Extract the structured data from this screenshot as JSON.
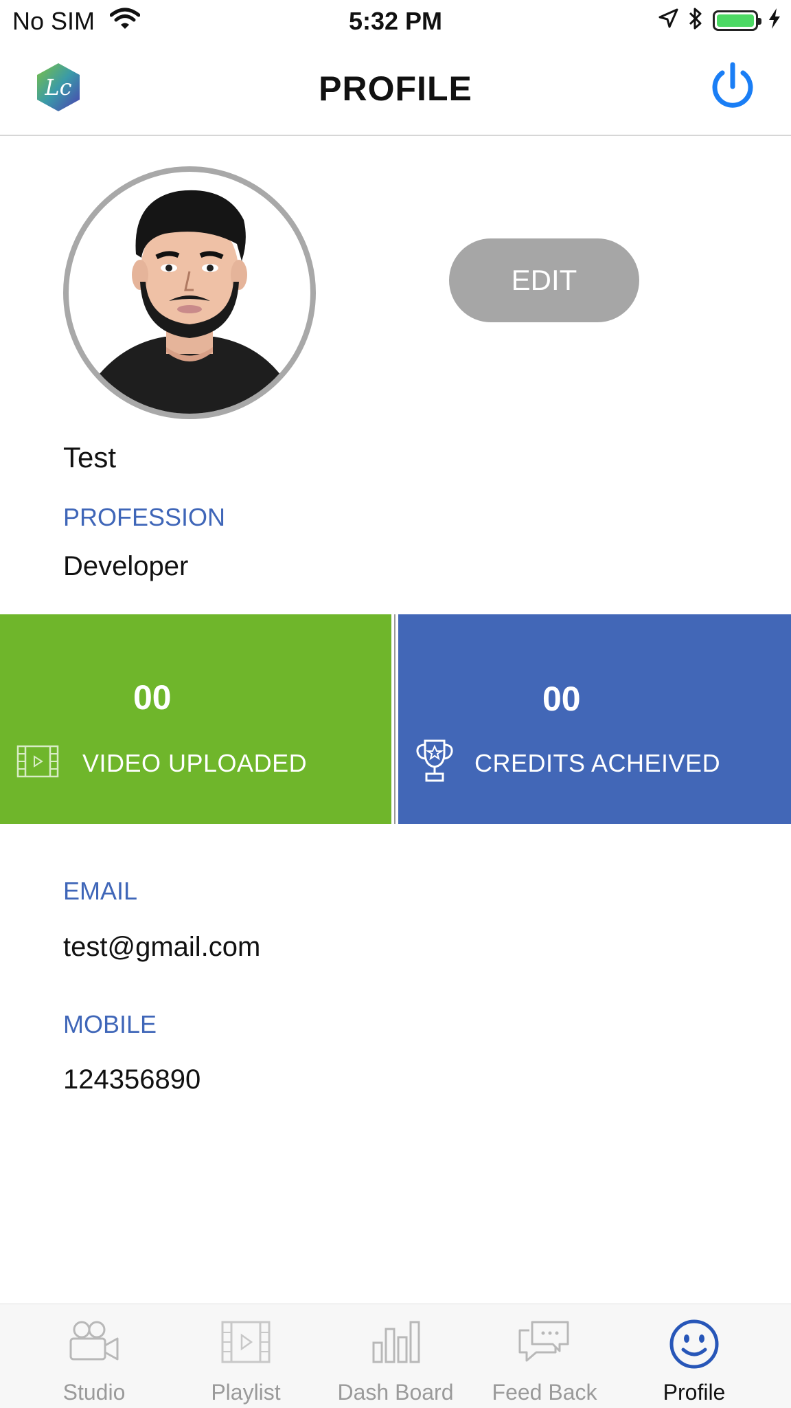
{
  "status_bar": {
    "carrier": "No SIM",
    "time": "5:32 PM"
  },
  "nav": {
    "title": "PROFILE"
  },
  "profile": {
    "edit_label": "EDIT",
    "name": "Test",
    "profession_label": "PROFESSION",
    "profession_value": "Developer",
    "email_label": "EMAIL",
    "email_value": "test@gmail.com",
    "mobile_label": "MOBILE",
    "mobile_value": "124356890"
  },
  "stats": {
    "videos": {
      "count": "00",
      "label": "VIDEO UPLOADED"
    },
    "credits": {
      "count": "00",
      "label": "CREDITS ACHEIVED"
    }
  },
  "colors": {
    "green": "#6fb62b",
    "blue": "#4267b7",
    "accent": "#1a7ef5"
  },
  "tabs": [
    {
      "label": "Studio",
      "icon": "video-camera-icon"
    },
    {
      "label": "Playlist",
      "icon": "film-icon"
    },
    {
      "label": "Dash Board",
      "icon": "bar-chart-icon"
    },
    {
      "label": "Feed Back",
      "icon": "chat-icon"
    },
    {
      "label": "Profile",
      "icon": "smiley-icon",
      "active": true
    }
  ]
}
